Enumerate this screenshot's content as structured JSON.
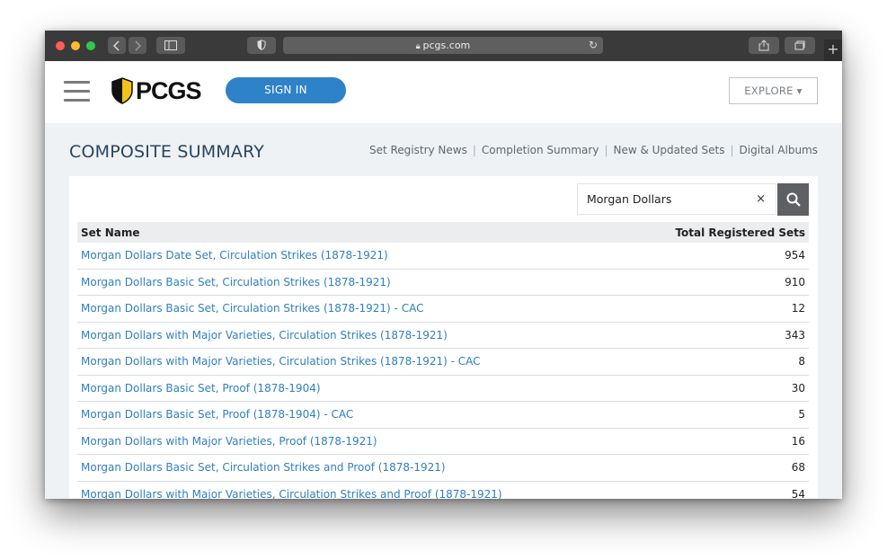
{
  "browser": {
    "url": "pcgs.com"
  },
  "header": {
    "logo_text": "PCGS",
    "signin_label": "SIGN IN",
    "explore_label": "EXPLORE ▾"
  },
  "page": {
    "title": "COMPOSITE SUMMARY",
    "nav": [
      "Set Registry News",
      "Completion Summary",
      "New & Updated Sets",
      "Digital Albums"
    ]
  },
  "search": {
    "value": "Morgan Dollars",
    "clear_label": "×"
  },
  "table": {
    "headers": {
      "name": "Set Name",
      "count": "Total Registered Sets"
    },
    "rows": [
      {
        "name": "Morgan Dollars Date Set, Circulation Strikes (1878-1921)",
        "count": "954"
      },
      {
        "name": "Morgan Dollars Basic Set, Circulation Strikes (1878-1921)",
        "count": "910"
      },
      {
        "name": "Morgan Dollars Basic Set, Circulation Strikes (1878-1921) - CAC",
        "count": "12"
      },
      {
        "name": "Morgan Dollars with Major Varieties, Circulation Strikes (1878-1921)",
        "count": "343"
      },
      {
        "name": "Morgan Dollars with Major Varieties, Circulation Strikes (1878-1921) - CAC",
        "count": "8"
      },
      {
        "name": "Morgan Dollars Basic Set, Proof (1878-1904)",
        "count": "30"
      },
      {
        "name": "Morgan Dollars Basic Set, Proof (1878-1904) - CAC",
        "count": "5"
      },
      {
        "name": "Morgan Dollars with Major Varieties, Proof (1878-1921)",
        "count": "16"
      },
      {
        "name": "Morgan Dollars Basic Set, Circulation Strikes and Proof (1878-1921)",
        "count": "68"
      },
      {
        "name": "Morgan Dollars with Major Varieties, Circulation Strikes and Proof (1878-1921)",
        "count": "54"
      }
    ]
  },
  "colors": {
    "accent": "#2e82c7",
    "link": "#2f7fc1",
    "title": "#2a4560"
  }
}
